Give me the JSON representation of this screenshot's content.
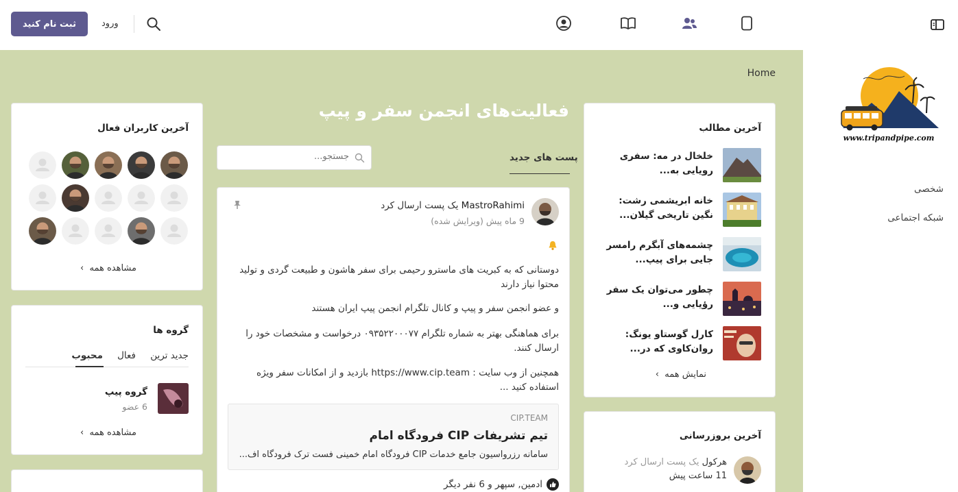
{
  "header": {
    "register_label": "ثبت نام کنید",
    "login_label": "ورود"
  },
  "sidebar": {
    "items": [
      {
        "label": "شخصی"
      },
      {
        "label": "شبکه اجتماعی"
      }
    ],
    "logo_text": "www.tripandpipe.com"
  },
  "breadcrumb": "Home",
  "page_title": "فعالیت‌های انجمن سفر و پیپ",
  "feed": {
    "tab_label": "پست های جدید",
    "search_placeholder": "جستجو...",
    "post": {
      "author": "MastroRahimi",
      "action": "یک پست ارسال کرد",
      "meta": "9 ماه پیش (ویرایش شده)",
      "paragraphs": [
        "دوستانی که به کبریت های ماسترو رحیمی برای سفر هاشون و طبیعت گردی و تولید محتوا نیاز دارند",
        "و عضو انجمن سفر و پیپ و کانال تلگرام انجمن پیپ ایران هستند",
        "برای هماهنگی بهتر به شماره تلگرام ۰۹۳۵۲۲۰۰۰۷۷ درخواست و مشخصات خود را ارسال کنند.",
        "همچنین از وب سایت : https://www.cip.team بازدید و از امکانات سفر ویژه استفاده کنید ..."
      ],
      "link_preview": {
        "domain": "CIP.TEAM",
        "title": "تیم تشریفات CIP فرودگاه امام",
        "description": "سامانه رزرواسیون جامع خدمات CIP فرودگاه امام خمینی فست ترک فرودگاه اف..."
      },
      "likes": "ادمین, سپهر و 6 نفر دیگر"
    }
  },
  "latest_articles": {
    "title": "آخرین مطالب",
    "items": [
      {
        "title": "خلخال در مه: سفری رویایی به..."
      },
      {
        "title": "خانه ابریشمی رشت: نگین تاریخی گیلان..."
      },
      {
        "title": "چشمه‌های آبگرم رامسر جایی برای پیپ..."
      },
      {
        "title": "چطور می‌توان یک سفر رؤیایی و..."
      },
      {
        "title": "کارل گوستاو یونگ: روان‌کاوی که در..."
      }
    ],
    "show_all": "نمایش همه"
  },
  "latest_updates": {
    "title": "آخرین بروزرسانی",
    "author": "هرکول",
    "action": "یک پست ارسال کرد",
    "time": "11 ساعت پیش"
  },
  "active_users": {
    "title": "آخرین کاربران فعال",
    "show_all": "مشاهده همه"
  },
  "groups": {
    "title": "گروه ها",
    "tabs": [
      {
        "label": "جدید ترین"
      },
      {
        "label": "فعال"
      },
      {
        "label": "محبوب"
      }
    ],
    "item": {
      "name": "گروه پیپ",
      "members": "6 عضو"
    },
    "show_all": "مشاهده همه"
  },
  "colors": {
    "accent": "#5e5a90",
    "background": "#cfd8ad",
    "nav_active": "#5e5a90"
  }
}
